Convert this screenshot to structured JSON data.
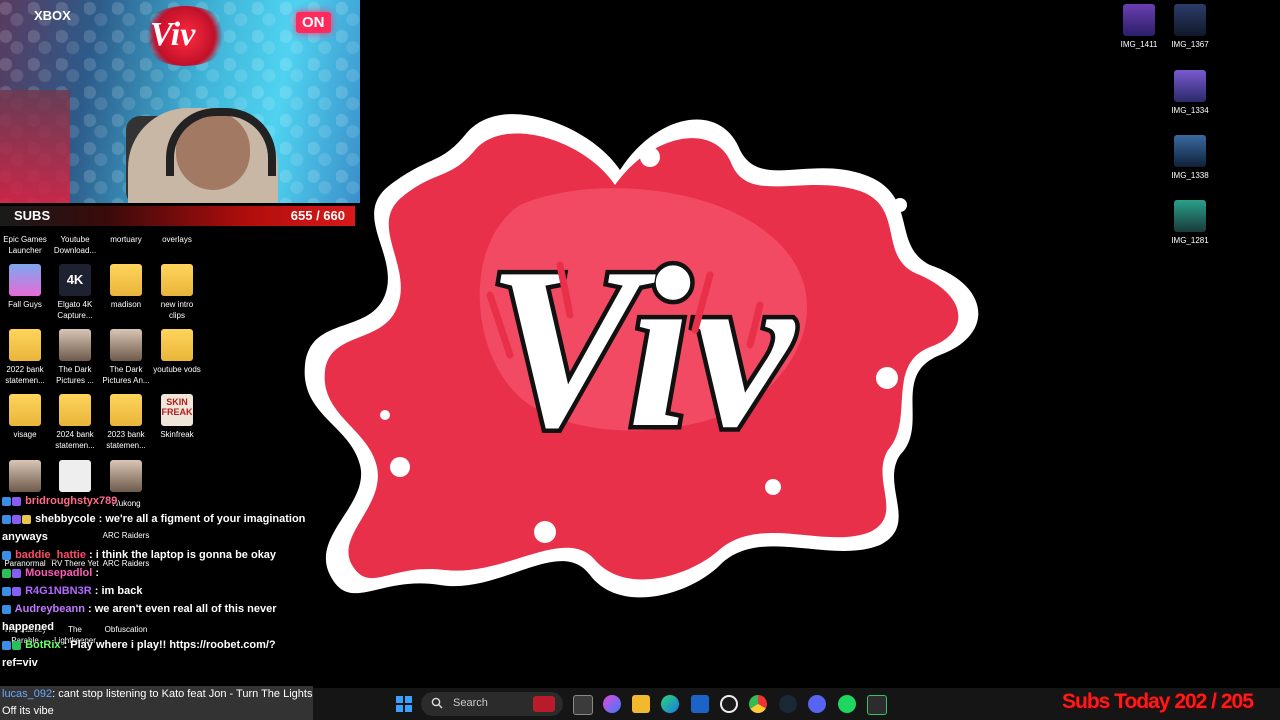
{
  "webcam": {
    "xbox_label": "XBOX",
    "neon_sign": "Viv",
    "onair_label": "ON"
  },
  "subs_goal": {
    "label": "SUBS",
    "value": "655 / 660"
  },
  "desktop_icons": {
    "epic": "Epic Games Launcher",
    "youtube_download": "Youtube Download...",
    "mortuary": "mortuary",
    "overlays": "overlays",
    "fall_guys": "Fall Guys",
    "elgato": "Elgato 4K Capture...",
    "madison": "madison",
    "new_intro": "new intro clips",
    "bank_2022": "2022 bank statemen...",
    "dark_pictures_1": "The Dark Pictures ...",
    "dark_pictures_2": "The Dark Pictures An...",
    "youtube_vods": "youtube vods",
    "visage": "visage",
    "bank_2024": "2024 bank statemen...",
    "bank_2023": "2023 bank statemen...",
    "skinfreak": "Skinfreak",
    "wukong": "Wukong",
    "arc_raiders": "ARC Raiders",
    "paranormal": "Paranormal",
    "rv_there_yet": "RV There Yet",
    "the_lightkeeper": "The Lightkeeper",
    "obfuscation": "Obfuscation",
    "the_stanley": "The Stanley Parable",
    "img_1411": "IMG_1411",
    "img_1367": "IMG_1367",
    "img_1334": "IMG_1334",
    "img_1338": "IMG_1338",
    "img_1281": "IMG_1281",
    "k4_glyph": "4K",
    "skin_glyph": "SKIN FREAK"
  },
  "chat": [
    {
      "user": "bridroughstyx789",
      "user_color": "#ff6a8a",
      "text": ""
    },
    {
      "user": "shebbycole",
      "user_color": "#ffffff",
      "text": ": we're all a figment of your imagination anyways"
    },
    {
      "user": "baddie_hattie",
      "user_color": "#ff4a6a",
      "text": ": i think the laptop is gonna be okay"
    },
    {
      "user": "Mousepadlol",
      "user_color": "#ff5ab8",
      "text": ":"
    },
    {
      "user": "R4G1NBN3R",
      "user_color": "#b06aff",
      "text": ": im back"
    },
    {
      "user": "Audreybeann",
      "user_color": "#c07aff",
      "text": ": we aren't even real all of this never happened"
    },
    {
      "user": "BotRix",
      "user_color": "#6bff6b",
      "text": ": Play where i play!! https://roobet.com/?ref=viv"
    }
  ],
  "chat_footer": {
    "user": "lucas_092",
    "text": ": cant stop listening to Kato feat Jon - Turn The Lights Off its vibe"
  },
  "taskbar": {
    "search_placeholder": "Search",
    "search_icon": "magnifier-icon"
  },
  "subs_today": {
    "label": "Subs Today",
    "value": "202 / 205"
  },
  "colors": {
    "subs_today": "#ff1a1a",
    "subs_bar": "#d81919",
    "logo_red": "#e8304a"
  }
}
